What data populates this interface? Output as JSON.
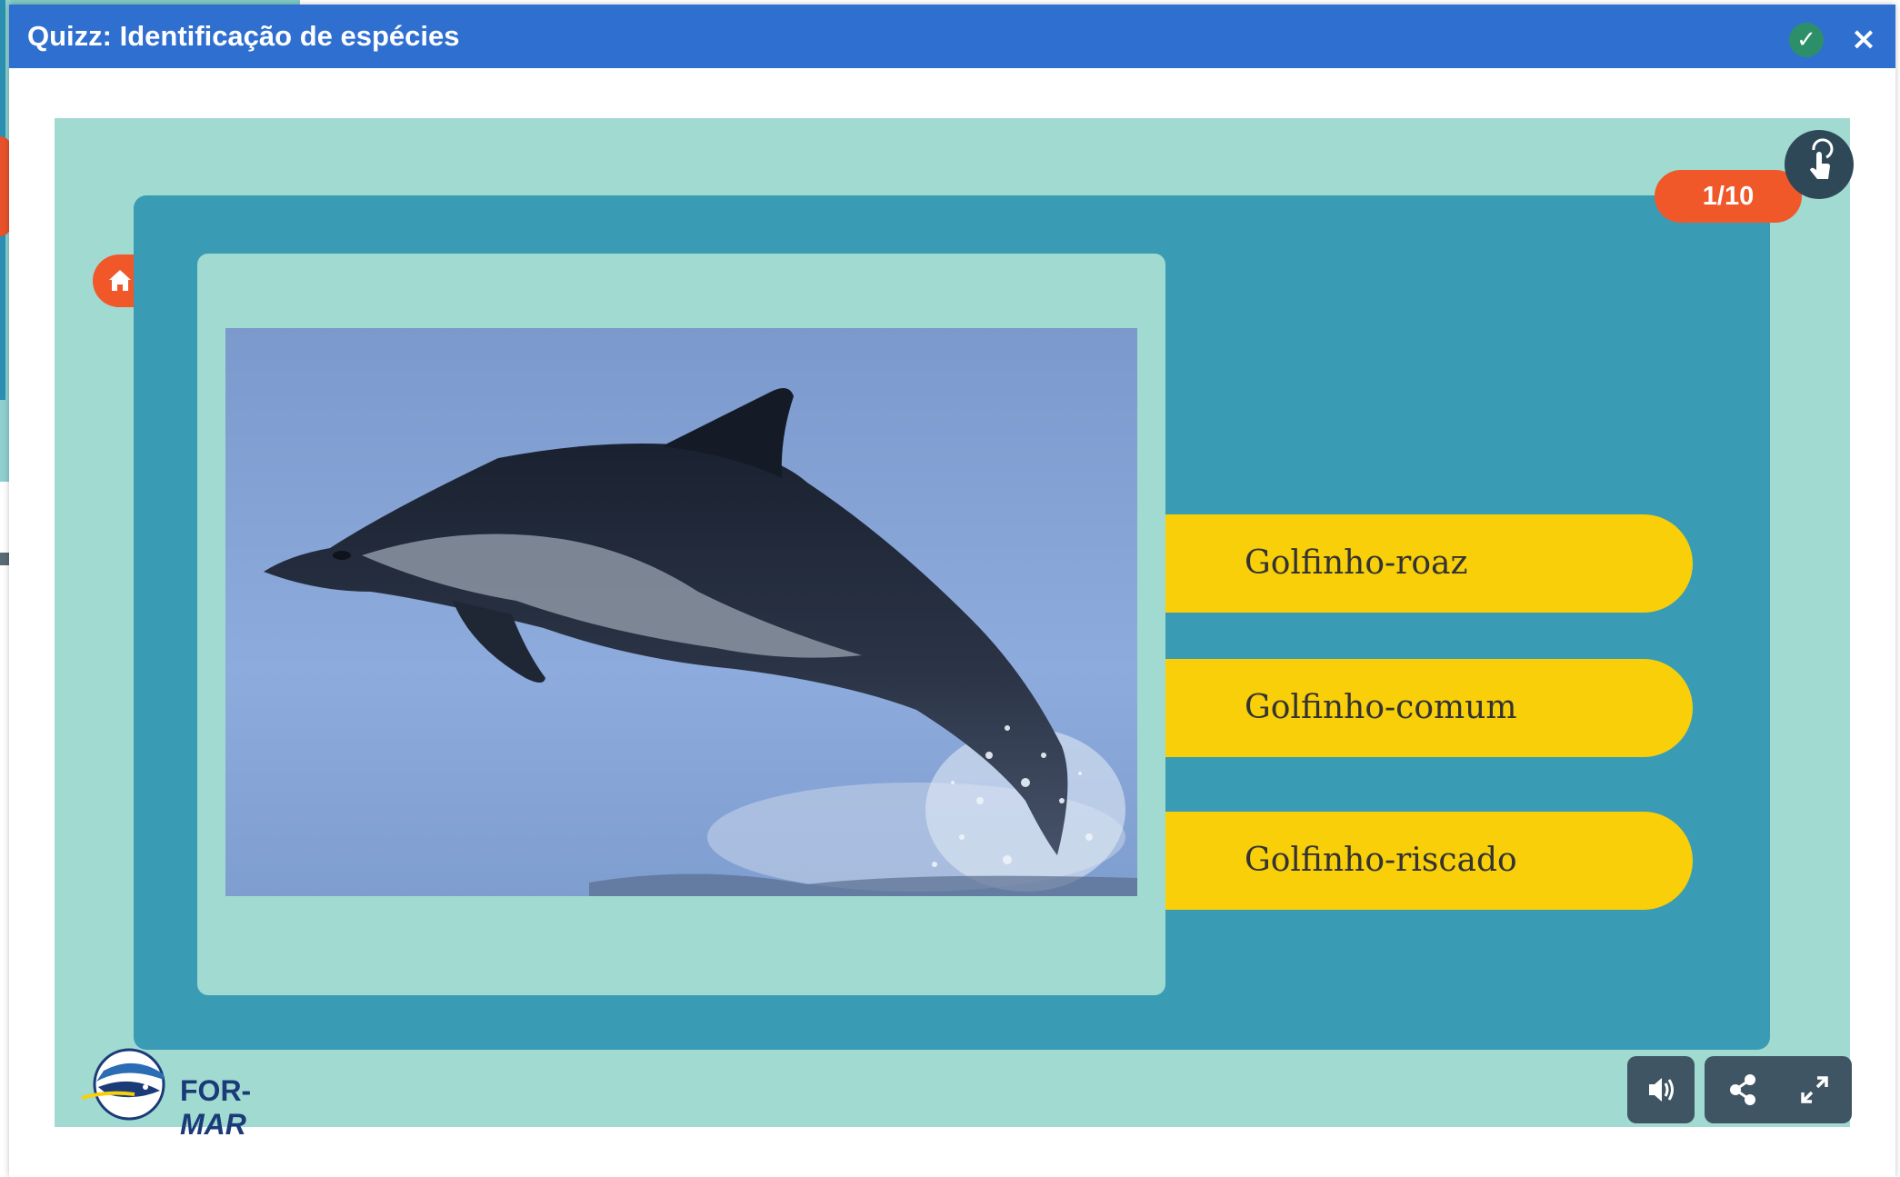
{
  "window": {
    "title": "Quizz: Identificação de espécies",
    "ok_icon": "check-icon",
    "close_icon": "close-icon",
    "title_bar_color": "#2f6fd0"
  },
  "quiz": {
    "counter": "1/10",
    "image": {
      "subject": "dolphin-photo"
    },
    "answers": [
      {
        "label": "Golfinho-roaz"
      },
      {
        "label": "Golfinho-comum"
      },
      {
        "label": "Golfinho-riscado"
      }
    ],
    "answer_color": "#f8cf08",
    "accent_color": "#f0582a",
    "panel_color": "#3a9bb5",
    "stage_color": "#a0dad0"
  },
  "logo": {
    "name_part1": "FOR-",
    "name_part2": "MAR"
  },
  "controls": {
    "home_icon": "home-icon",
    "accessibility_icon": "hand-pointer-icon",
    "audio_icon": "volume-icon",
    "share_icon": "share-icon",
    "fullscreen_icon": "expand-icon"
  }
}
